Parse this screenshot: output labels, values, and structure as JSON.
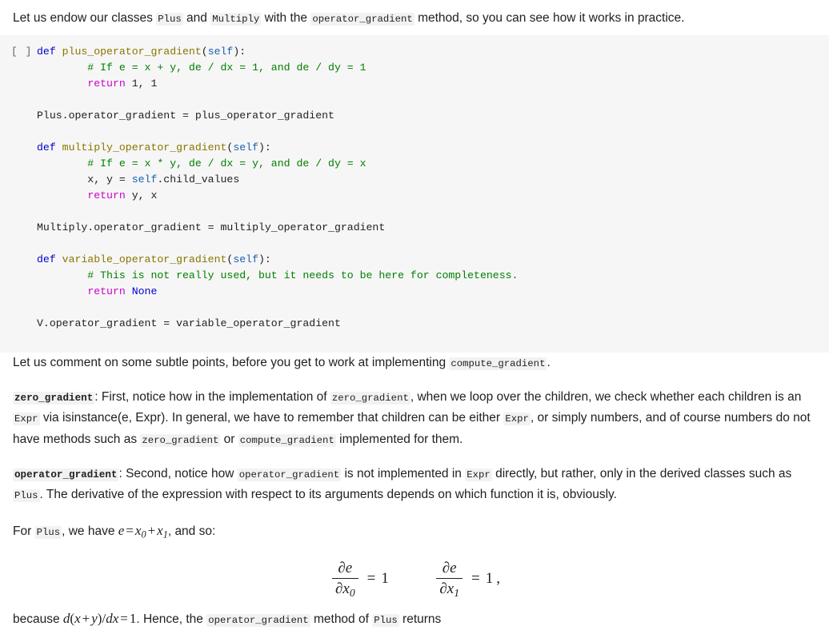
{
  "intro": {
    "before": "Let us endow our classes ",
    "code1": "Plus",
    "mid1": " and ",
    "code2": "Multiply",
    "mid2": " with the ",
    "code3": "operator_gradient",
    "after": " method, so you can see how it works in practice."
  },
  "cell": {
    "prompt": "[ ]",
    "lines": [
      {
        "segs": [
          {
            "t": "def ",
            "c": "kw"
          },
          {
            "t": "plus_operator_gradient",
            "c": "fn"
          },
          {
            "t": "(",
            "c": "op"
          },
          {
            "t": "self",
            "c": "self"
          },
          {
            "t": "):",
            "c": "op"
          }
        ]
      },
      {
        "segs": [
          {
            "t": "        # If e = x + y, de / dx = 1, and de / dy = 1",
            "c": "com"
          }
        ]
      },
      {
        "segs": [
          {
            "t": "        ",
            "c": "op"
          },
          {
            "t": "return",
            "c": "kw2"
          },
          {
            "t": " 1, 1",
            "c": "num"
          }
        ]
      },
      {
        "segs": [
          {
            "t": "",
            "c": "op"
          }
        ]
      },
      {
        "segs": [
          {
            "t": "Plus.operator_gradient = plus_operator_gradient",
            "c": "cls"
          }
        ]
      },
      {
        "segs": [
          {
            "t": "",
            "c": "op"
          }
        ]
      },
      {
        "segs": [
          {
            "t": "def ",
            "c": "kw"
          },
          {
            "t": "multiply_operator_gradient",
            "c": "fn"
          },
          {
            "t": "(",
            "c": "op"
          },
          {
            "t": "self",
            "c": "self"
          },
          {
            "t": "):",
            "c": "op"
          }
        ]
      },
      {
        "segs": [
          {
            "t": "        # If e = x * y, de / dx = y, and de / dy = x",
            "c": "com"
          }
        ]
      },
      {
        "segs": [
          {
            "t": "        x, y = ",
            "c": "op"
          },
          {
            "t": "self",
            "c": "self"
          },
          {
            "t": ".child_values",
            "c": "op"
          }
        ]
      },
      {
        "segs": [
          {
            "t": "        ",
            "c": "op"
          },
          {
            "t": "return",
            "c": "kw2"
          },
          {
            "t": " y, x",
            "c": "num"
          }
        ]
      },
      {
        "segs": [
          {
            "t": "",
            "c": "op"
          }
        ]
      },
      {
        "segs": [
          {
            "t": "Multiply.operator_gradient = multiply_operator_gradient",
            "c": "cls"
          }
        ]
      },
      {
        "segs": [
          {
            "t": "",
            "c": "op"
          }
        ]
      },
      {
        "segs": [
          {
            "t": "def ",
            "c": "kw"
          },
          {
            "t": "variable_operator_gradient",
            "c": "fn"
          },
          {
            "t": "(",
            "c": "op"
          },
          {
            "t": "self",
            "c": "self"
          },
          {
            "t": "):",
            "c": "op"
          }
        ]
      },
      {
        "segs": [
          {
            "t": "        # This is not really used, but it needs to be here for completeness.",
            "c": "com"
          }
        ]
      },
      {
        "segs": [
          {
            "t": "        ",
            "c": "op"
          },
          {
            "t": "return",
            "c": "kw2"
          },
          {
            "t": " ",
            "c": "op"
          },
          {
            "t": "None",
            "c": "const"
          }
        ]
      },
      {
        "segs": [
          {
            "t": "",
            "c": "op"
          }
        ]
      },
      {
        "segs": [
          {
            "t": "V.operator_gradient = variable_operator_gradient",
            "c": "cls"
          }
        ]
      }
    ]
  },
  "p1": {
    "a": "Let us comment on some subtle points, before you get to work at implementing ",
    "code1": "compute_gradient",
    "b": "."
  },
  "p2": {
    "lead": "zero_gradient",
    "a": ": First, notice how in the implementation of ",
    "code1": "zero_gradient",
    "b": ", when we loop over the children, we check whether each children is an ",
    "code2": "Expr",
    "c": " via isinstance(e, Expr). In general, we have to remember that children can be either ",
    "code3": "Expr",
    "d": ", or simply numbers, and of course numbers do not have methods such as ",
    "code4": "zero_gradient",
    "e": " or ",
    "code5": "compute_gradient",
    "f": " implemented for them."
  },
  "p3": {
    "lead": "operator_gradient",
    "a": ": Second, notice how ",
    "code1": "operator_gradient",
    "b": " is not implemented in ",
    "code2": "Expr",
    "c": " directly, but rather, only in the derived classes such as ",
    "code3": "Plus",
    "d": ". The derivative of the expression with respect to its arguments depends on which function it is, obviously."
  },
  "p4": {
    "a": "For ",
    "code1": "Plus",
    "b": ", we have ",
    "math_e": "e",
    "math_eq": "=",
    "math_x0": "x",
    "math_x0sub": "0",
    "math_plus": "+",
    "math_x1": "x",
    "math_x1sub": "1",
    "c": ", and so:"
  },
  "math_display": {
    "left": {
      "num": "∂e",
      "den_d": "∂x",
      "den_sub": "0",
      "eq": "=",
      "rhs": "1"
    },
    "right": {
      "num": "∂e",
      "den_d": "∂x",
      "den_sub": "1",
      "eq": "=",
      "rhs": "1",
      "trail": ","
    }
  },
  "p5": {
    "a": "because ",
    "m_d": "d",
    "m_lp": "(",
    "m_x": "x",
    "m_plus": "+",
    "m_y": "y",
    "m_rp": ")",
    "m_slash": "/",
    "m_dx": "dx",
    "m_eq": "=",
    "m_one": "1",
    "b": ". Hence, the ",
    "code1": "operator_gradient",
    "c": " method of ",
    "code2": "Plus",
    "d": " returns"
  },
  "colors": {
    "keyword": "#0000cd",
    "keyword2": "#cc00cc",
    "function": "#8a7500",
    "comment": "#008000",
    "self": "#1a5fb4",
    "code_bg": "#f6f6f6",
    "inline_code_bg": "#f2f2f2",
    "text": "#202124"
  }
}
